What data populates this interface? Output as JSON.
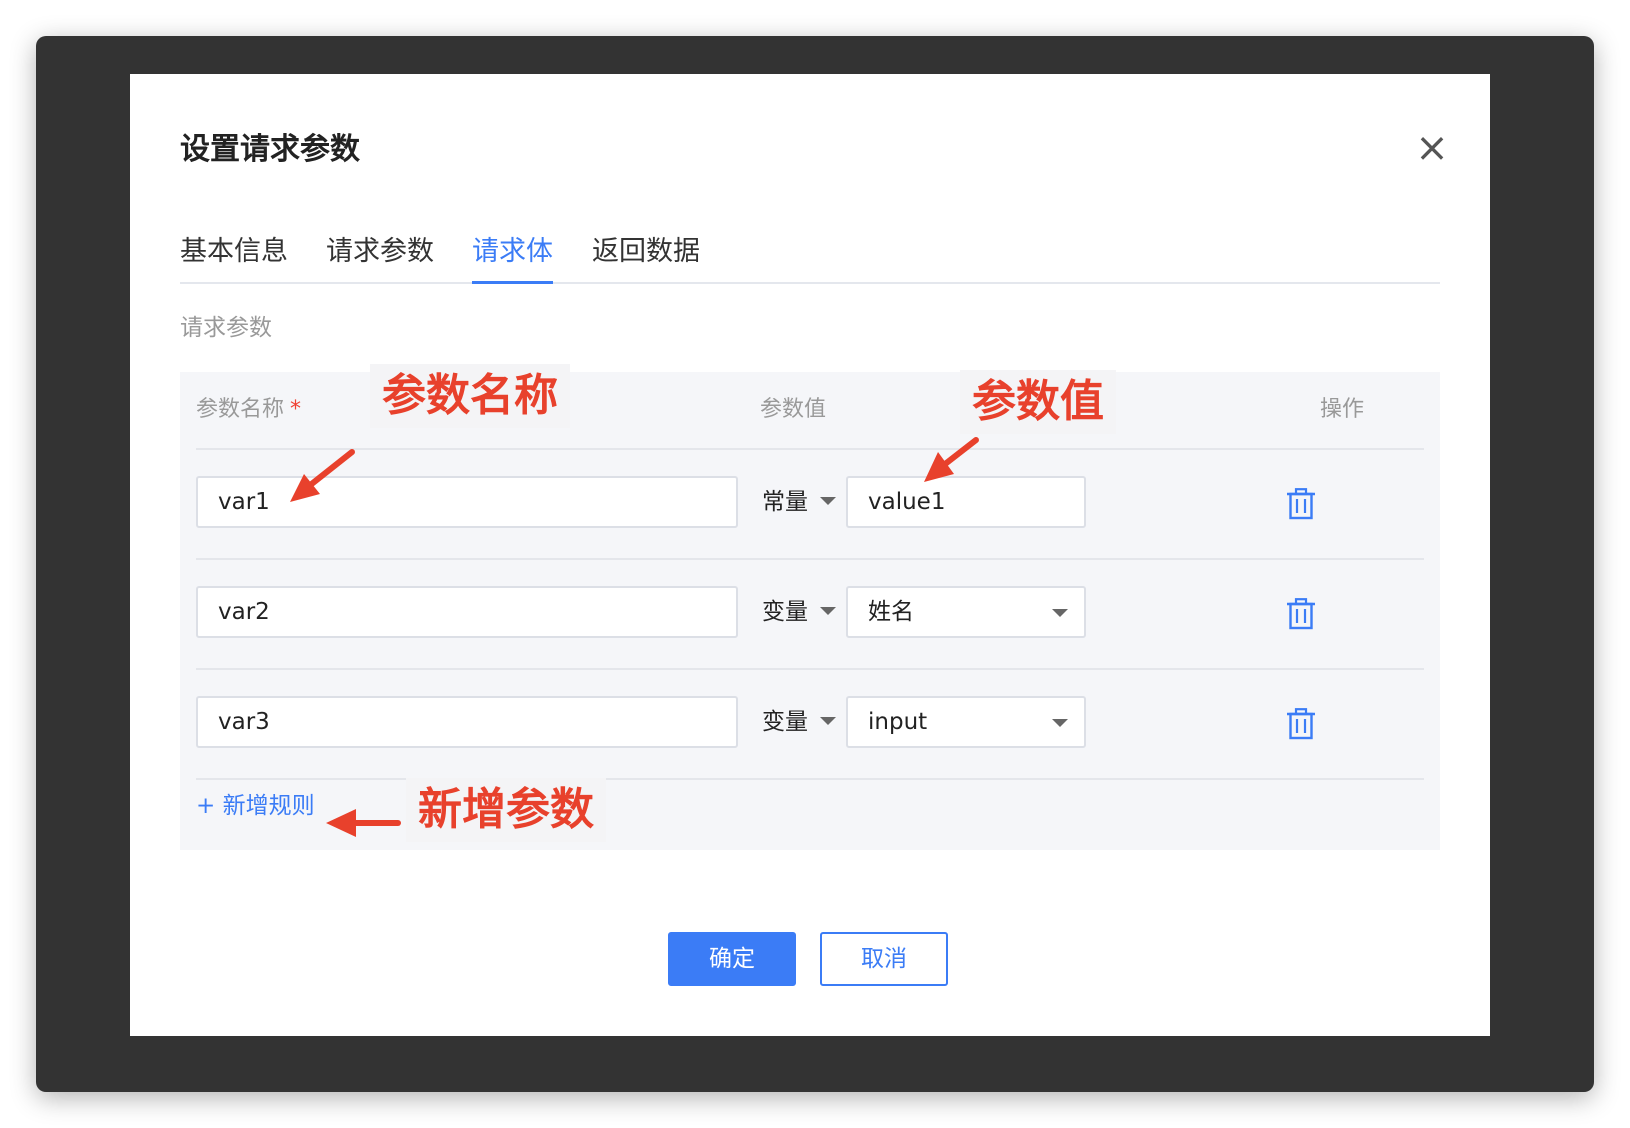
{
  "dialog": {
    "title": "设置请求参数",
    "close_symbol": "×"
  },
  "tabs": [
    {
      "label": "基本信息",
      "active": false
    },
    {
      "label": "请求参数",
      "active": false
    },
    {
      "label": "请求体",
      "active": true
    },
    {
      "label": "返回数据",
      "active": false
    }
  ],
  "section_label": "请求参数",
  "table": {
    "headers": {
      "name": "参数名称",
      "required_mark": "*",
      "value": "参数值",
      "action": "操作"
    },
    "rows": [
      {
        "name": "var1",
        "type": "常量",
        "value": "value1",
        "value_is_select": false
      },
      {
        "name": "var2",
        "type": "变量",
        "value": "姓名",
        "value_is_select": true
      },
      {
        "name": "var3",
        "type": "变量",
        "value": "input",
        "value_is_select": true
      }
    ],
    "add_rule": "+ 新增规则"
  },
  "annotations": {
    "param_name": "参数名称",
    "param_value": "参数值",
    "add_param": "新增参数"
  },
  "buttons": {
    "confirm": "确定",
    "cancel": "取消"
  },
  "colors": {
    "accent": "#3b7cf6",
    "annotation": "#e8412c",
    "frame": "#333333"
  },
  "icons": {
    "close": "close-icon",
    "delete": "trash-icon",
    "dropdown": "caret-down-icon"
  }
}
